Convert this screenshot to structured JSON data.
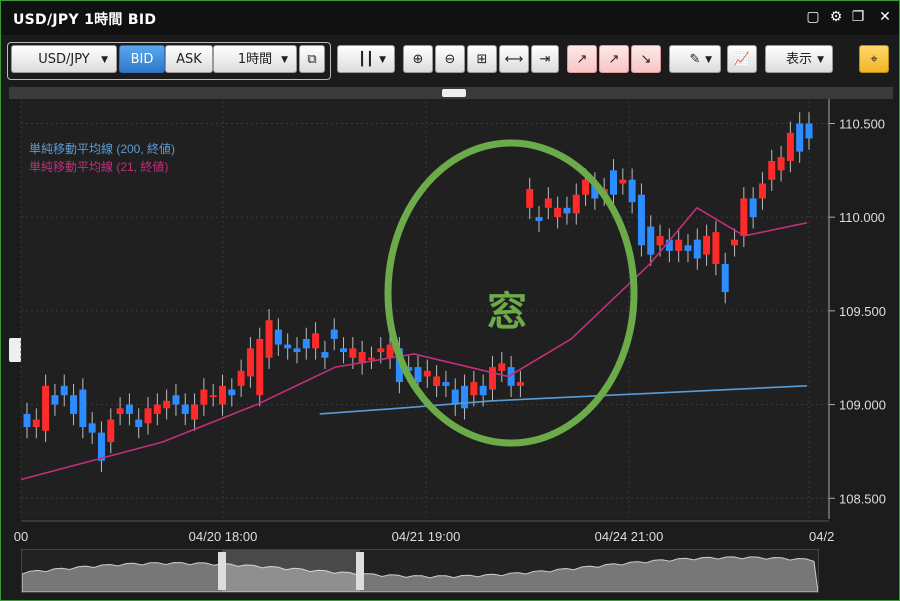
{
  "window": {
    "title": "USD/JPY 1時間 BID"
  },
  "toolbar": {
    "pair": "USD/JPY",
    "bid_label": "BID",
    "ask_label": "ASK",
    "timeframe": "1時間",
    "display_label": "表示"
  },
  "chart_data": {
    "type": "candlestick",
    "yaxis_ticks": [
      "110.500",
      "110.000",
      "109.500",
      "109.000",
      "108.500"
    ],
    "ylim": [
      108.4,
      110.62
    ],
    "xaxis_labels": [
      "00",
      "04/20 18:00",
      "04/21 19:00",
      "04/24 21:00",
      "04/2"
    ],
    "legend": [
      {
        "label": "単純移動平均線 (200, 終値)",
        "color": "#5b9bd5"
      },
      {
        "label": "単純移動平均線 (21, 終値)",
        "color": "#c0307a"
      }
    ],
    "candles_open": [
      108.95,
      108.88,
      108.86,
      109.05,
      109.1,
      109.05,
      109.08,
      108.9,
      108.85,
      108.8,
      108.95,
      109.0,
      108.92,
      108.9,
      108.95,
      108.98,
      109.05,
      109.0,
      108.92,
      109.0,
      109.05,
      109.0,
      109.08,
      109.1,
      109.15,
      109.05,
      109.25,
      109.4,
      109.32,
      109.3,
      109.35,
      109.3,
      109.28,
      109.4,
      109.3,
      109.25,
      109.22,
      109.25,
      109.28,
      109.25,
      109.3,
      109.2,
      109.2,
      109.15,
      109.1,
      109.12,
      109.08,
      109.1,
      109.05,
      109.1,
      109.08,
      109.18,
      109.2,
      109.1,
      110.05,
      110.0,
      110.05,
      110.0,
      110.05,
      110.02,
      110.12,
      110.18,
      110.12,
      110.25,
      110.18,
      110.2,
      110.12,
      109.95,
      109.85,
      109.88,
      109.82,
      109.85,
      109.88,
      109.8,
      109.75,
      109.75,
      109.85,
      109.9,
      110.1,
      110.1,
      110.2,
      110.25,
      110.3,
      110.5,
      110.5
    ],
    "candles_close": [
      108.88,
      108.92,
      109.1,
      109.0,
      109.05,
      108.95,
      108.88,
      108.85,
      108.7,
      108.92,
      108.98,
      108.95,
      108.88,
      108.98,
      109.0,
      109.02,
      109.0,
      108.95,
      109.0,
      109.08,
      109.05,
      109.1,
      109.05,
      109.18,
      109.3,
      109.35,
      109.45,
      109.32,
      109.3,
      109.28,
      109.3,
      109.38,
      109.25,
      109.35,
      109.28,
      109.3,
      109.28,
      109.25,
      109.3,
      109.32,
      109.12,
      109.18,
      109.12,
      109.18,
      109.15,
      109.1,
      109.0,
      108.98,
      109.12,
      109.05,
      109.2,
      109.22,
      109.1,
      109.12,
      110.15,
      109.98,
      110.1,
      110.05,
      110.02,
      110.12,
      110.2,
      110.1,
      110.15,
      110.12,
      110.2,
      110.08,
      109.85,
      109.8,
      109.9,
      109.82,
      109.88,
      109.82,
      109.78,
      109.9,
      109.92,
      109.6,
      109.88,
      110.1,
      110.0,
      110.18,
      110.3,
      110.32,
      110.45,
      110.35,
      110.42
    ],
    "sma200": [
      [
        0,
        0.0
      ],
      [
        0.38,
        108.95
      ],
      [
        0.48,
        108.98
      ],
      [
        0.6,
        109.02
      ],
      [
        0.75,
        109.05
      ],
      [
        1.0,
        109.1
      ]
    ],
    "sma21": [
      [
        0,
        108.6
      ],
      [
        0.18,
        108.8
      ],
      [
        0.3,
        109.0
      ],
      [
        0.4,
        109.2
      ],
      [
        0.5,
        109.27
      ],
      [
        0.62,
        109.15
      ],
      [
        0.7,
        109.35
      ],
      [
        0.8,
        109.75
      ],
      [
        0.86,
        110.05
      ],
      [
        0.92,
        109.9
      ],
      [
        1.0,
        109.97
      ]
    ]
  },
  "annotation": {
    "text": "窓"
  }
}
